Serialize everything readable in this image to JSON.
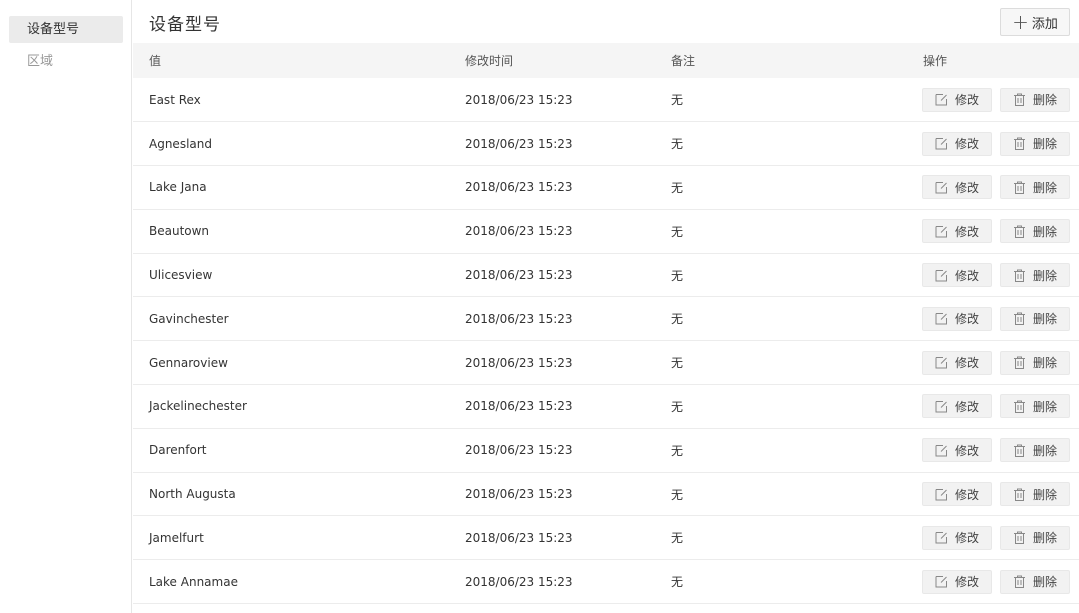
{
  "sidebar": {
    "items": [
      {
        "label": "设备型号",
        "active": true
      },
      {
        "label": "区域",
        "active": false
      }
    ]
  },
  "header": {
    "title": "设备型号",
    "add_label": "添加"
  },
  "table": {
    "columns": [
      "值",
      "修改时间",
      "备注",
      "操作"
    ],
    "rows": [
      {
        "value": "East Rex",
        "modified": "2018/06/23 15:23",
        "note": "无"
      },
      {
        "value": "Agnesland",
        "modified": "2018/06/23 15:23",
        "note": "无"
      },
      {
        "value": "Lake Jana",
        "modified": "2018/06/23 15:23",
        "note": "无"
      },
      {
        "value": "Beautown",
        "modified": "2018/06/23 15:23",
        "note": "无"
      },
      {
        "value": "Ulicesview",
        "modified": "2018/06/23 15:23",
        "note": "无"
      },
      {
        "value": "Gavinchester",
        "modified": "2018/06/23 15:23",
        "note": "无"
      },
      {
        "value": "Gennaroview",
        "modified": "2018/06/23 15:23",
        "note": "无"
      },
      {
        "value": "Jackelinechester",
        "modified": "2018/06/23 15:23",
        "note": "无"
      },
      {
        "value": "Darenfort",
        "modified": "2018/06/23 15:23",
        "note": "无"
      },
      {
        "value": "North Augusta",
        "modified": "2018/06/23 15:23",
        "note": "无"
      },
      {
        "value": "Jamelfurt",
        "modified": "2018/06/23 15:23",
        "note": "无"
      },
      {
        "value": "Lake Annamae",
        "modified": "2018/06/23 15:23",
        "note": "无"
      }
    ],
    "edit_label": "修改",
    "delete_label": "删除"
  },
  "icons": {
    "add": "plus-icon",
    "edit": "edit-icon",
    "delete": "trash-icon"
  }
}
